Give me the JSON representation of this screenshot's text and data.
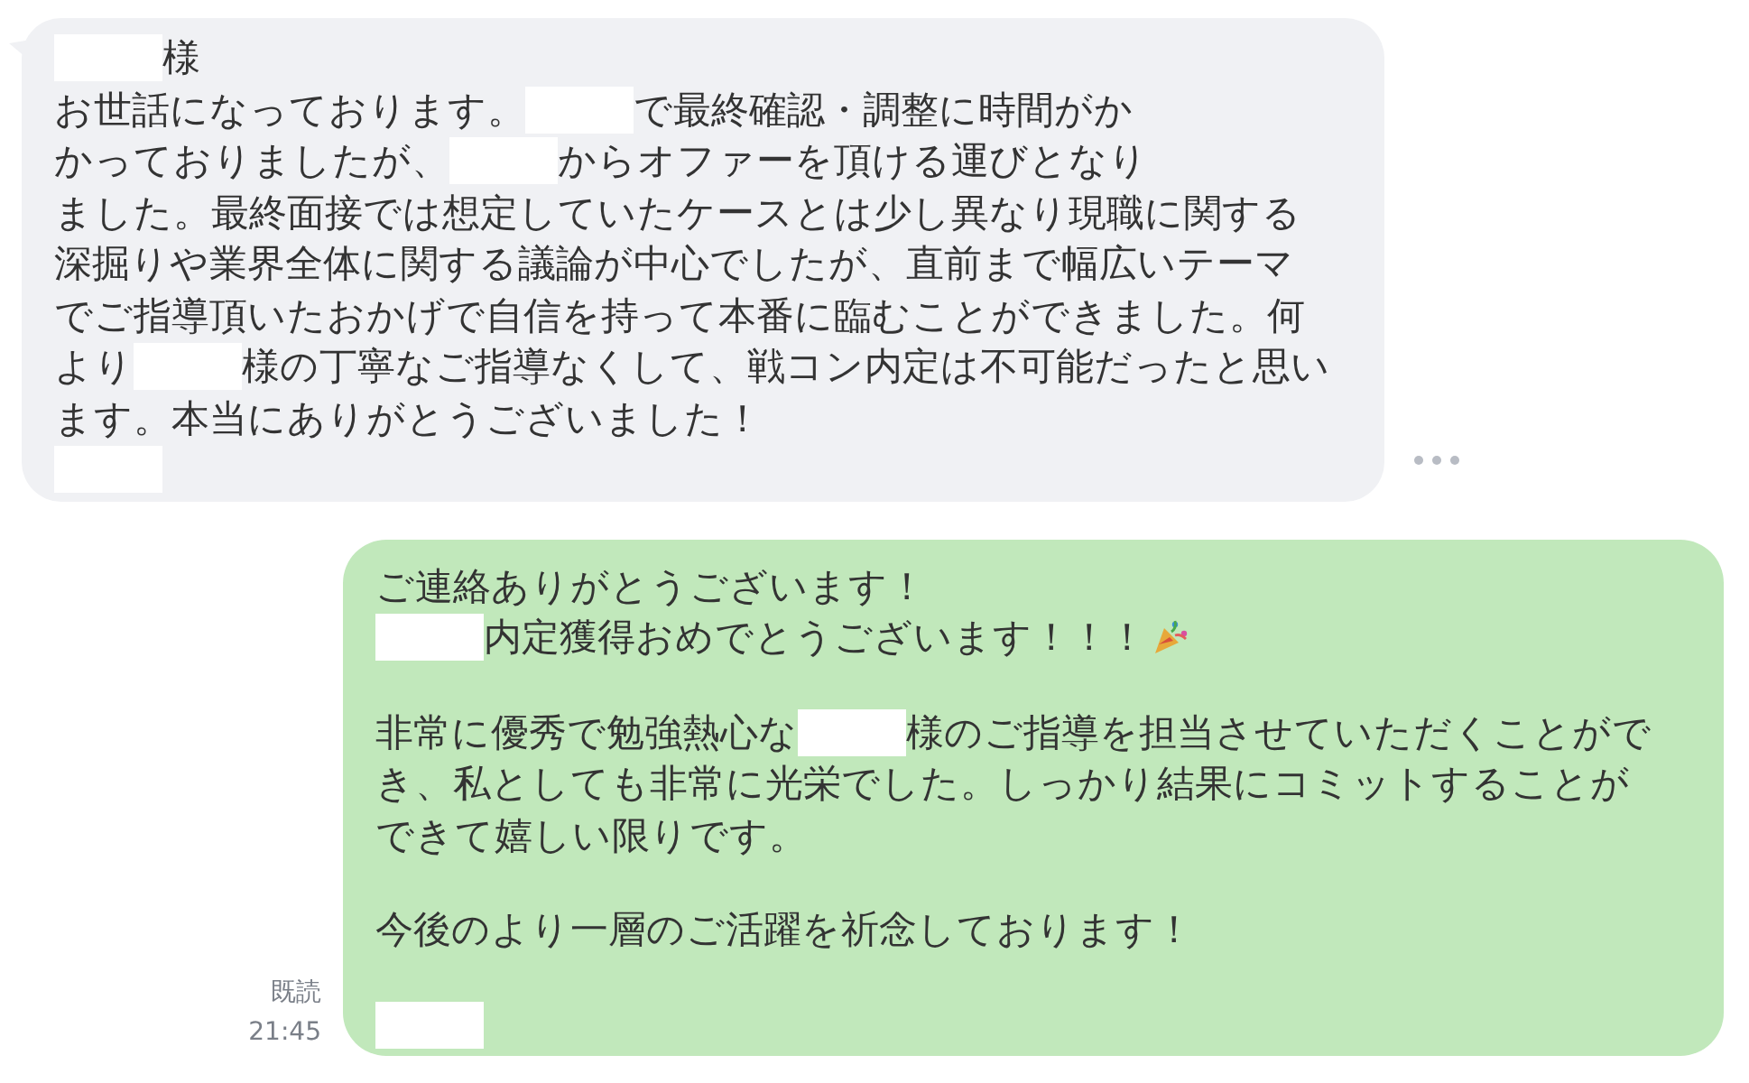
{
  "messages": [
    {
      "kind": "received",
      "paragraphs": [
        [
          [
            {
              "kind": "redacted"
            },
            {
              "kind": "text",
              "text": "様"
            }
          ],
          [
            {
              "kind": "text",
              "text": "お世話になっております。"
            },
            {
              "kind": "redacted"
            },
            {
              "kind": "text",
              "text": "で最終確認・調整に時間がか"
            }
          ],
          [
            {
              "kind": "text",
              "text": "かっておりましたが、"
            },
            {
              "kind": "redacted"
            },
            {
              "kind": "text",
              "text": "からオファーを頂ける運びとなり"
            }
          ],
          [
            {
              "kind": "text",
              "text": "ました。最終面接では想定していたケースとは少し異なり現職に関する"
            }
          ],
          [
            {
              "kind": "text",
              "text": "深掘りや業界全体に関する議論が中心でしたが、直前まで幅広いテーマ"
            }
          ],
          [
            {
              "kind": "text",
              "text": "でご指導頂いたおかげで自信を持って本番に臨むことができました。何"
            }
          ],
          [
            {
              "kind": "text",
              "text": "より"
            },
            {
              "kind": "redacted"
            },
            {
              "kind": "text",
              "text": "様の丁寧なご指導なくして、戦コン内定は不可能だったと思い"
            }
          ],
          [
            {
              "kind": "text",
              "text": "ます。本当にありがとうございました！"
            }
          ],
          [
            {
              "kind": "redacted"
            }
          ]
        ]
      ]
    },
    {
      "kind": "sent",
      "read_label": "既読",
      "time": "21:45",
      "paragraphs": [
        [
          [
            {
              "kind": "text",
              "text": "ご連絡ありがとうございます！"
            }
          ],
          [
            {
              "kind": "redacted"
            },
            {
              "kind": "text",
              "text": "内定獲得おめでとうございます！！！"
            },
            {
              "kind": "icon"
            }
          ]
        ],
        [
          [
            {
              "kind": "text",
              "text": "非常に優秀で勉強熱心な"
            },
            {
              "kind": "redacted"
            },
            {
              "kind": "text",
              "text": "様のご指導を担当させていただくことがで"
            }
          ],
          [
            {
              "kind": "text",
              "text": "き、私としても非常に光栄でした。しっかり結果にコミットすることが"
            }
          ],
          [
            {
              "kind": "text",
              "text": "できて嬉しい限りです。"
            }
          ]
        ],
        [
          [
            {
              "kind": "text",
              "text": "今後のより一層のご活躍を祈念しております！"
            }
          ]
        ],
        [
          [
            {
              "kind": "redacted"
            }
          ]
        ]
      ]
    }
  ]
}
